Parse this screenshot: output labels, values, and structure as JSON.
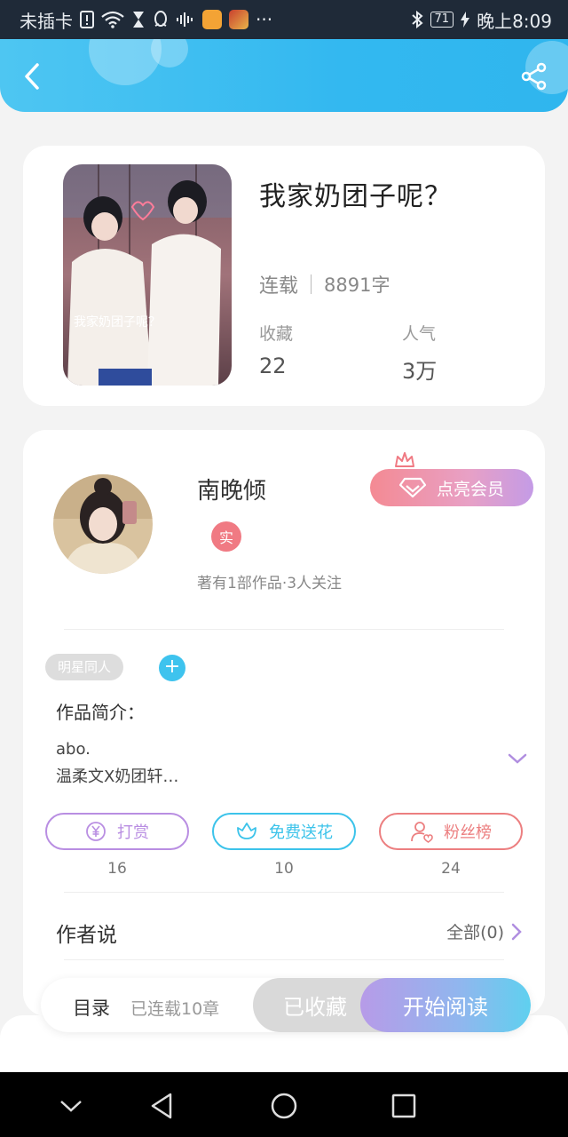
{
  "status_bar": {
    "carrier": "未插卡",
    "battery": "71",
    "time": "晚上8:09",
    "more": "···"
  },
  "header": {
    "back_icon": "chevron-left-icon",
    "share_icon": "share-icon"
  },
  "book": {
    "title": "我家奶团子呢？",
    "cover_caption": "我家奶团子呢？",
    "status": "连载",
    "word_count": "8891字",
    "stats": [
      {
        "label": "收藏",
        "value": "22"
      },
      {
        "label": "人气",
        "value": "3万"
      }
    ]
  },
  "author": {
    "name": "南晚倾",
    "badge": "实",
    "meta": "著有1部作品·3人关注",
    "vip_label": "点亮会员"
  },
  "tags": [
    "明星同人"
  ],
  "add_tag_label": "+",
  "intro": {
    "title": "作品简介：",
    "lines": [
      "abo.",
      "温柔文X奶团轩…"
    ]
  },
  "actions": [
    {
      "label": "打赏",
      "count": "16",
      "icon": "yen-icon",
      "color": "#b98ee2"
    },
    {
      "label": "免费送花",
      "count": "10",
      "icon": "flower-icon",
      "color": "#3cc3ea"
    },
    {
      "label": "粉丝榜",
      "count": "24",
      "icon": "person-heart-icon",
      "color": "#ec7f80"
    }
  ],
  "author_says": {
    "title": "作者说",
    "all_label": "全部(0)"
  },
  "bottom_bar": {
    "toc_label": "目录",
    "toc_sub": "已连载10章",
    "favorited_label": "已收藏",
    "read_label": "开始阅读"
  },
  "colors": {
    "header_blue": "#33b8f0",
    "vip_pink": "#f48a93",
    "accent_purple": "#b98ee2"
  }
}
